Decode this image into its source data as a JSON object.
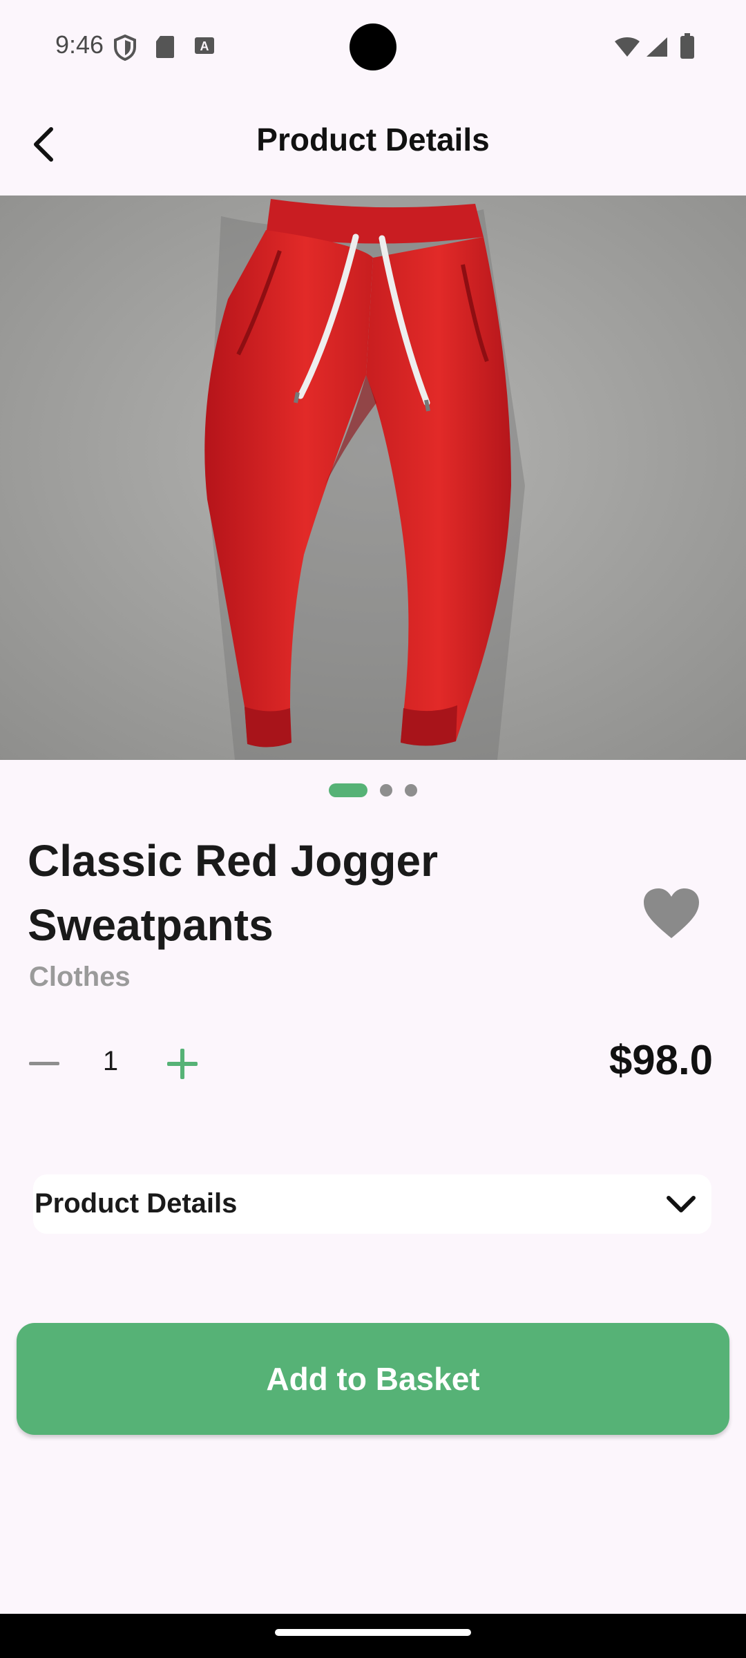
{
  "status_bar": {
    "time": "9:46",
    "icons_left": [
      "shield-icon",
      "sd-card-icon",
      "keyboard-a-icon"
    ],
    "icons_right": [
      "wifi-icon",
      "signal-icon",
      "battery-icon"
    ]
  },
  "header": {
    "title": "Product Details",
    "back_icon": "chevron-left-icon"
  },
  "product": {
    "image_alt": "red-jogger-sweatpants-photo",
    "carousel": {
      "total": 3,
      "active_index": 0
    },
    "title": "Classic Red Jogger Sweatpants",
    "category": "Clothes",
    "favorite_icon": "heart-icon",
    "quantity": "1",
    "price": "$98.0"
  },
  "details": {
    "label": "Product Details",
    "chevron_icon": "chevron-down-icon"
  },
  "cta": {
    "label": "Add to Basket"
  },
  "colors": {
    "accent": "#56B276",
    "background": "#FCF6FC",
    "muted": "#9A9A9A",
    "heart": "#8A8A8A"
  }
}
